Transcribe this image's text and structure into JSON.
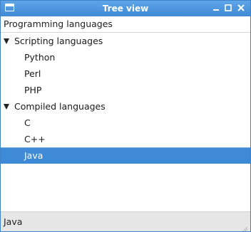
{
  "window": {
    "title": "Tree view",
    "icon": "window-icon",
    "controls": [
      "minimize-icon",
      "maximize-icon",
      "close-icon"
    ]
  },
  "column_header": "Programming languages",
  "tree": {
    "groups": [
      {
        "label": "Scripting languages",
        "expanded": true,
        "items": [
          "Python",
          "Perl",
          "PHP"
        ]
      },
      {
        "label": "Compiled languages",
        "expanded": true,
        "items": [
          "C",
          "C++",
          "Java"
        ]
      }
    ],
    "selected": "Java"
  },
  "status": "Java",
  "colors": {
    "accent": "#3f8ad6",
    "selection_text": "#ffffff"
  }
}
